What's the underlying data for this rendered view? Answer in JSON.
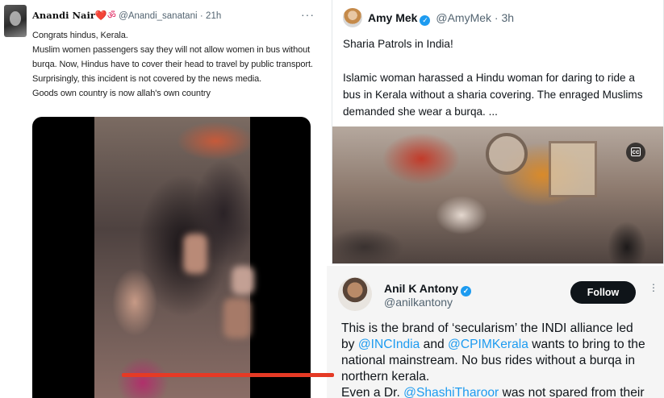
{
  "left_tweet": {
    "name": "Anandi Nair",
    "emoji_heart": "❤️",
    "emoji_om": "ॐ",
    "handle": "@Anandi_sanatani",
    "separator": "·",
    "time": "21h",
    "more": "···",
    "lines": [
      "Congrats hindus, Kerala.",
      "Muslim women passengers say they will not allow women in bus without",
      "burqa. Now, Hindus have to cover their head to travel by public transport.",
      "Surprisingly, this incident is not covered by the news media.",
      "Goods own country is now allah's own country"
    ]
  },
  "top_right_tweet": {
    "name": "Amy Mek",
    "verified_mark": "✓",
    "handle": "@AmyMek",
    "separator": "·",
    "time": "3h",
    "line1": "Sharia Patrols in India!",
    "body_lines": [
      "Islamic woman harassed a Hindu woman for daring to ride a",
      "bus in Kerala without a sharia covering. The enraged Muslims",
      "demanded she wear a burqa. ..."
    ],
    "cc_label": "cc"
  },
  "bottom_right_tweet": {
    "name": "Anil K Antony",
    "verified_mark": "✓",
    "handle": "@anilkantony",
    "follow_label": "Follow",
    "more": "⋮",
    "line1": "This is the brand of ‘secularism’ the INDI alliance led",
    "line2_pre": "by ",
    "line2_mention1": "@INCIndia",
    "line2_mid": " and ",
    "line2_mention2": "@CPIMKerala",
    "line2_post": " wants to bring to the",
    "line3": "national mainstream. No bus rides without a burqa in",
    "line4": "northern kerala.",
    "line5_pre": "Even a Dr. ",
    "line5_mention": "@ShashiTharoor",
    "line5_post": " was not spared from their"
  },
  "colors": {
    "link": "#1d9bf0",
    "underline": "#e53a25",
    "verified": "#1d9bf0",
    "heart": "#e0245e"
  }
}
